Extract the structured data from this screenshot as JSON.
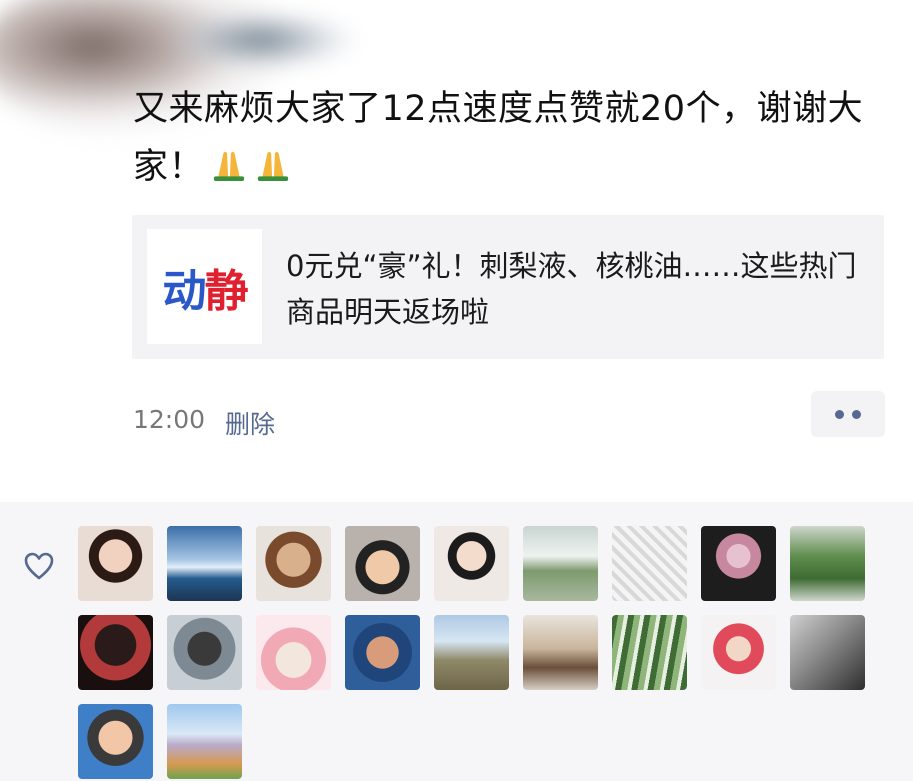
{
  "post": {
    "text": "又来麻烦大家了12点速度点赞就20个，谢谢大家！",
    "emoji": [
      "folded-hands-icon",
      "folded-hands-icon"
    ],
    "time": "12:00",
    "delete_label": "删除"
  },
  "link_card": {
    "logo_part1": "动",
    "logo_part2": "静",
    "title": "0元兑“豪”礼！刺梨液、核桃油……这些热门商品明天返场啦"
  },
  "likes": {
    "icon": "heart-outline-icon",
    "count": 20
  },
  "colors": {
    "link_blue": "#56698f",
    "logo_blue": "#2a58c8",
    "logo_red": "#e0202e",
    "card_bg": "#f3f3f5",
    "likes_bg": "#f6f6f8"
  }
}
